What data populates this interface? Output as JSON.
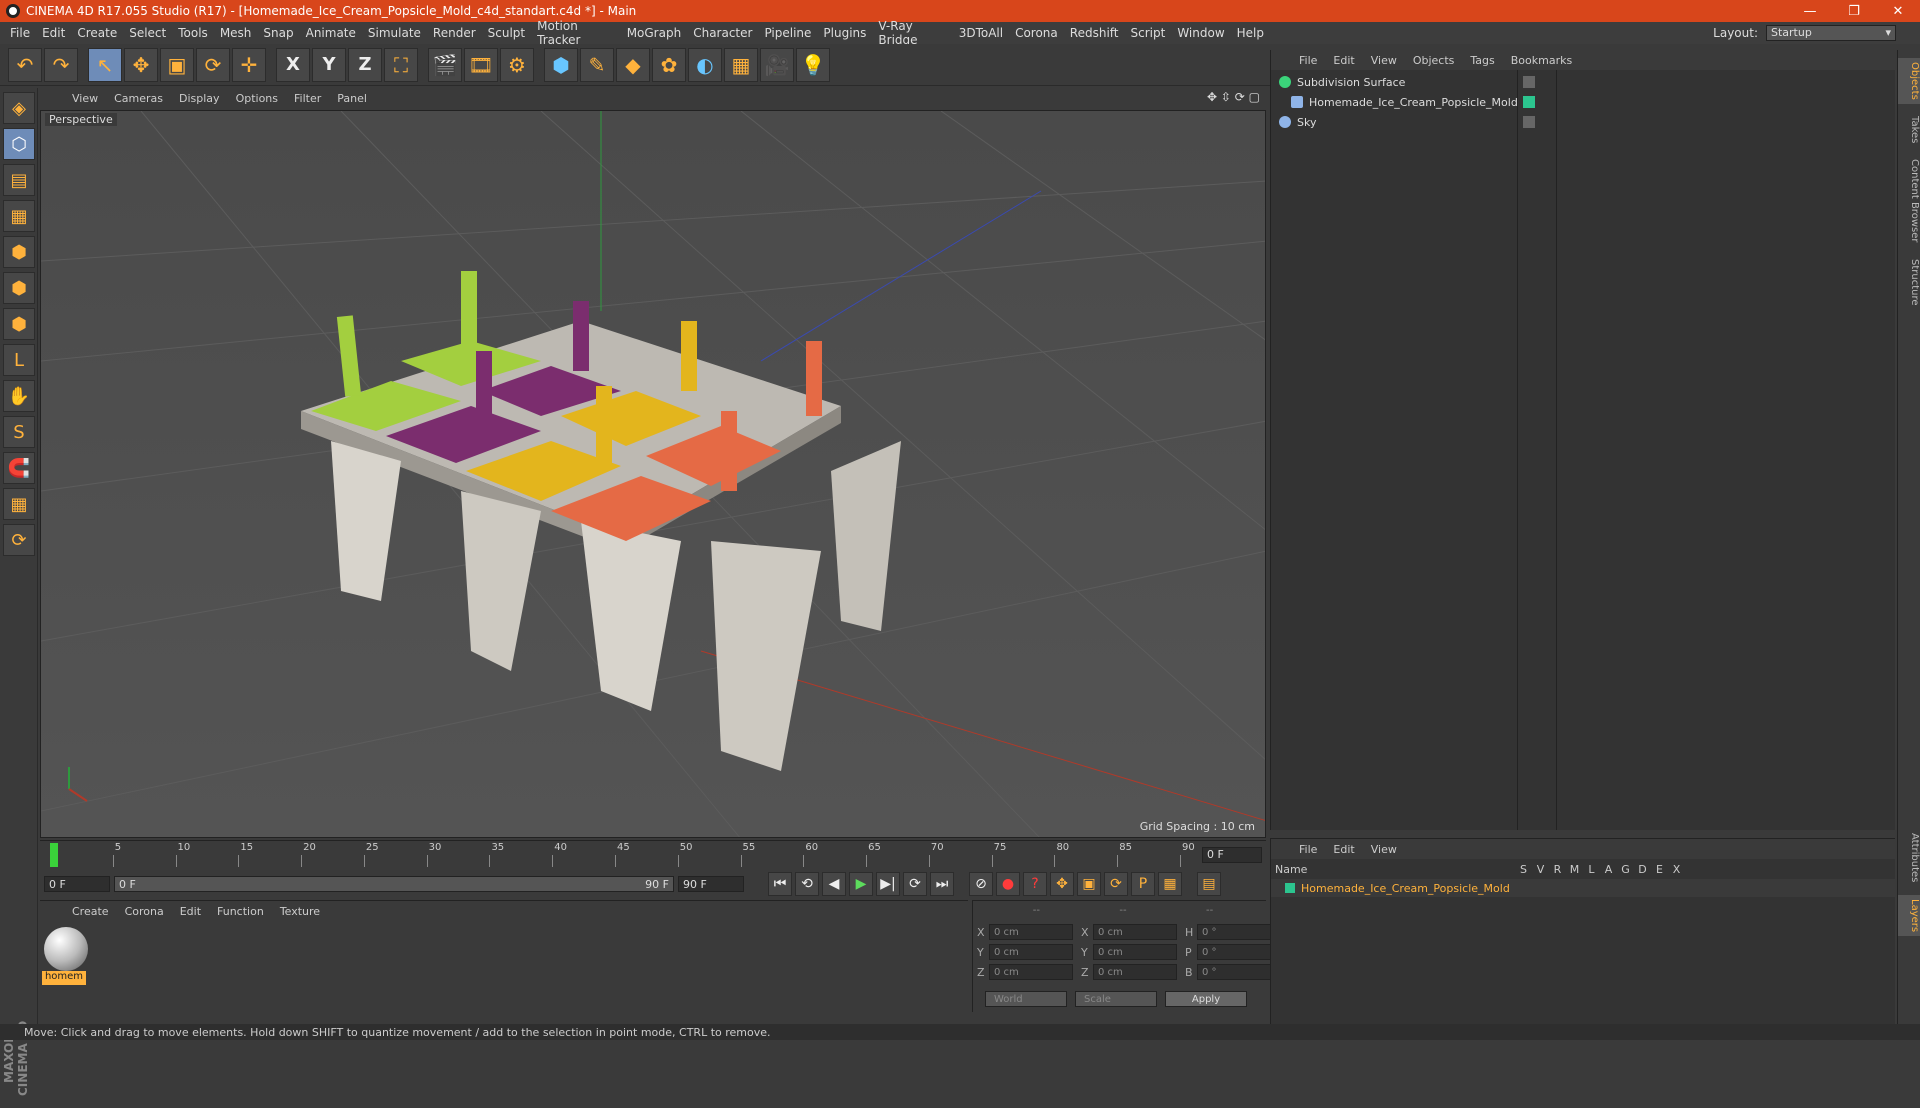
{
  "window": {
    "title": "CINEMA 4D R17.055 Studio (R17) - [Homemade_Ice_Cream_Popsicle_Mold_c4d_standart.c4d *] - Main",
    "minimize": "—",
    "maximize": "❐",
    "close": "✕"
  },
  "menu": [
    "File",
    "Edit",
    "Create",
    "Select",
    "Tools",
    "Mesh",
    "Snap",
    "Animate",
    "Simulate",
    "Render",
    "Sculpt",
    "Motion Tracker",
    "MoGraph",
    "Character",
    "Pipeline",
    "Plugins",
    "V-Ray Bridge",
    "3DToAll",
    "Corona",
    "Redshift",
    "Script",
    "Window",
    "Help"
  ],
  "layout": {
    "label": "Layout:",
    "value": "Startup"
  },
  "toolbar": {
    "undo": "↶",
    "redo": "↷",
    "select": "↖",
    "move": "✥",
    "scale": "▣",
    "rotate": "⟳",
    "axis": "✛",
    "x": "X",
    "y": "Y",
    "z": "Z",
    "coord": "⛶",
    "render_view": "🎬",
    "render_pic": "🎞",
    "render_settings": "⚙",
    "cube": "⬢",
    "pen": "✎",
    "subdiv": "◆",
    "array": "✿",
    "deformer": "◐",
    "floor": "▦",
    "camera": "🎥",
    "light": "💡"
  },
  "left_tools": [
    "◈",
    "⬡",
    "▤",
    "▦",
    "⬢",
    "⬢",
    "⬢",
    "L",
    "✋",
    "S",
    "🧲",
    "▦",
    "⟳"
  ],
  "viewport": {
    "menu": [
      "View",
      "Cameras",
      "Display",
      "Options",
      "Filter",
      "Panel"
    ],
    "nav_icons": "✥ ⇳ ⟳ ▢",
    "label": "Perspective",
    "grid_spacing": "Grid Spacing : 10 cm"
  },
  "timeline": {
    "ticks": [
      "0",
      "5",
      "10",
      "15",
      "20",
      "25",
      "30",
      "35",
      "40",
      "45",
      "50",
      "55",
      "60",
      "65",
      "70",
      "75",
      "80",
      "85",
      "90"
    ],
    "current_frame": "0 F"
  },
  "transport": {
    "start": "0 F",
    "range_start": "0 F",
    "range_end": "90 F",
    "end": "90 F",
    "buttons": [
      "⏮",
      "⟲",
      "◀",
      "▶",
      "▶|",
      "⟳",
      "⏭"
    ],
    "key_buttons": [
      "⊘",
      "●",
      "?",
      "✥",
      "▣",
      "⟳",
      "P",
      "▦",
      "▤"
    ]
  },
  "material_manager": {
    "menu": [
      "Create",
      "Corona",
      "Edit",
      "Function",
      "Texture"
    ],
    "material_name": "homem"
  },
  "coords": {
    "headers": [
      "--",
      "--",
      "--"
    ],
    "rows": [
      {
        "a": "X",
        "av": "0 cm",
        "b": "X",
        "bv": "0 cm",
        "c": "H",
        "cv": "0 °"
      },
      {
        "a": "Y",
        "av": "0 cm",
        "b": "Y",
        "bv": "0 cm",
        "c": "P",
        "cv": "0 °"
      },
      {
        "a": "Z",
        "av": "0 cm",
        "b": "Z",
        "bv": "0 cm",
        "c": "B",
        "cv": "0 °"
      }
    ],
    "world": "World",
    "scale": "Scale",
    "apply": "Apply"
  },
  "object_manager": {
    "menu": [
      "File",
      "Edit",
      "View",
      "Objects",
      "Tags",
      "Bookmarks"
    ],
    "objects": [
      {
        "name": "Subdivision Surface",
        "color": "#3bd37a"
      },
      {
        "name": "Homemade_Ice_Cream_Popsicle_Mold",
        "color": "#8fb4e8"
      },
      {
        "name": "Sky",
        "color": "#8fb4e8"
      }
    ]
  },
  "layer_manager": {
    "menu": [
      "File",
      "Edit",
      "View"
    ],
    "headers": {
      "name": "Name",
      "cols": [
        "S",
        "V",
        "R",
        "M",
        "L",
        "A",
        "G",
        "D",
        "E",
        "X"
      ]
    },
    "layer": "Homemade_Ice_Cream_Popsicle_Mold"
  },
  "right_tabs": [
    "Objects",
    "Takes",
    "Content Browser",
    "Structure",
    "Attributes",
    "Layers"
  ],
  "status": "Move: Click and drag to move elements. Hold down SHIFT to quantize movement / add to the selection in point mode, CTRL to remove.",
  "maxon": "MAXON CINEMA 4D",
  "popsicle": {
    "colors": [
      "#a3cf3f",
      "#7b2d6e",
      "#e3b51d",
      "#e56a45",
      "#a3cf3f",
      "#7b2d6e",
      "#e3b51d",
      "#e56a45"
    ],
    "mold_color": "#d8d4cc"
  }
}
